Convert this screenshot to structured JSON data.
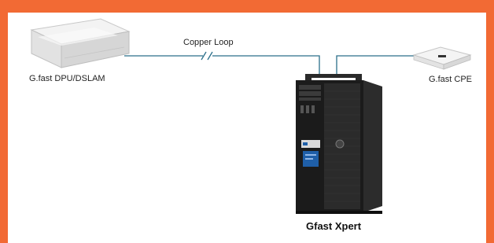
{
  "colors": {
    "border": "#f26a34",
    "link_line": "#2b6f8a",
    "tower_body": "#1a1a1a",
    "badge_blue": "#1f5fa8"
  },
  "devices": {
    "dslam": {
      "label": "G.fast DPU/DSLAM",
      "icon": "network-appliance-icon"
    },
    "cpe": {
      "label": "G.fast CPE",
      "icon": "modem-router-icon"
    },
    "xpert": {
      "label": "Gfast Xpert",
      "icon": "tower-pc-icon"
    }
  },
  "link": {
    "label": "Copper Loop",
    "break_symbol": "line-break-icon"
  }
}
